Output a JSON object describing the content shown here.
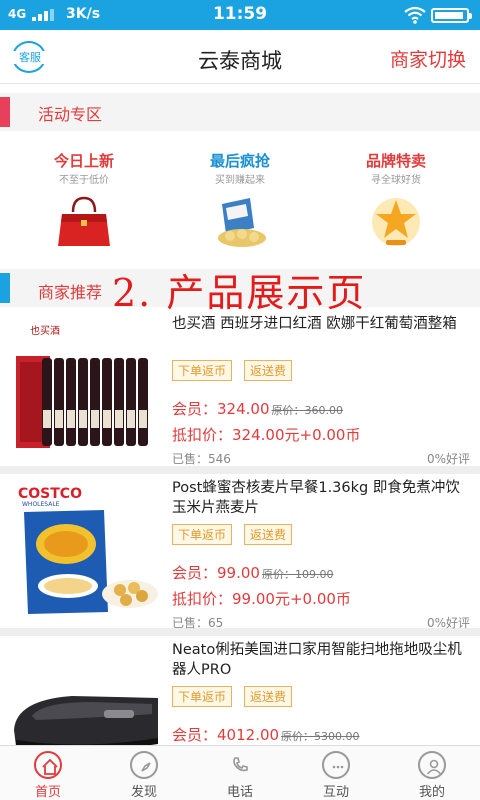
{
  "status_bar": {
    "network": "4G",
    "speed": "3K/s",
    "time": "11:59"
  },
  "header": {
    "service_label": "客服",
    "title": "云泰商城",
    "switch_label": "商家切换"
  },
  "activity": {
    "title": "活动专区",
    "promos": [
      {
        "title": "今日上新",
        "subtitle": "不至于低价",
        "color": "#e33b3b",
        "icon": "red-handbag-icon"
      },
      {
        "title": "最后疯抢",
        "subtitle": "买到赚起来",
        "color": "#1a8fd4",
        "icon": "snack-box-icon"
      },
      {
        "title": "品牌特卖",
        "subtitle": "寻全球好货",
        "color": "#e33b3b",
        "icon": "gold-badge-icon"
      }
    ]
  },
  "recommend": {
    "title": "商家推荐",
    "caption": "2. 产品展示页"
  },
  "products": [
    {
      "name": "也买酒 西班牙进口红酒 欧娜干红葡萄酒整箱",
      "tags": [
        "下单返币",
        "返送费"
      ],
      "member_label": "会员：",
      "member_price": "324.00",
      "original_price": "原价：360.00",
      "deduct_label": "抵扣价：",
      "deduct_price": "324.00元+0.00币",
      "sold": "已售：546",
      "rating": "0%好评",
      "brand": "也买酒"
    },
    {
      "name": "Post蜂蜜杏核麦片早餐1.36kg 即食免煮冲饮玉米片燕麦片",
      "tags": [
        "下单返币",
        "返送费"
      ],
      "member_label": "会员：",
      "member_price": "99.00",
      "original_price": "原价：109.00",
      "deduct_label": "抵扣价：",
      "deduct_price": "99.00元+0.00币",
      "sold": "已售：65",
      "rating": "0%好评",
      "brand": "COSTCO",
      "brand_sub": "WHOLESALE"
    },
    {
      "name": "Neato俐拓美国进口家用智能扫地拖地吸尘机器人PRO",
      "tags": [
        "下单返币",
        "返送费"
      ],
      "member_label": "会员：",
      "member_price": "4012.00",
      "original_price": "原价：5300.00"
    }
  ],
  "bottom_nav": [
    {
      "label": "首页",
      "icon": "home-icon",
      "active": true
    },
    {
      "label": "发现",
      "icon": "compass-icon",
      "active": false
    },
    {
      "label": "电话",
      "icon": "phone-icon",
      "active": false
    },
    {
      "label": "互动",
      "icon": "chat-icon",
      "active": false
    },
    {
      "label": "我的",
      "icon": "user-icon",
      "active": false
    }
  ],
  "colors": {
    "accent": "#e33b3b",
    "status_bar": "#1aa3e0",
    "tag": "#e39a2c"
  }
}
